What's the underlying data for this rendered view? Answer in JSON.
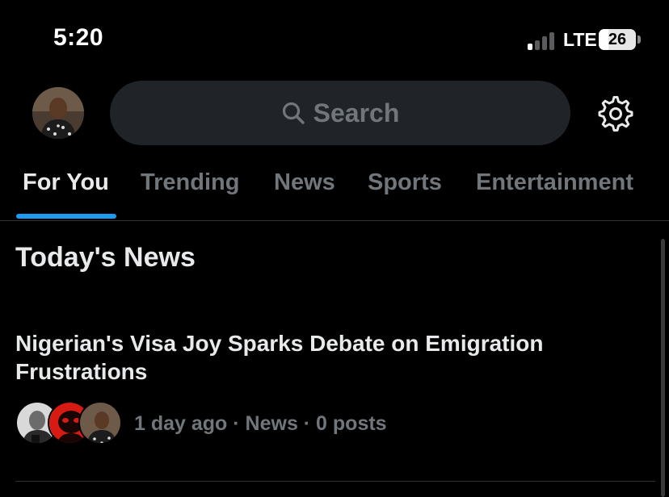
{
  "status_bar": {
    "time": "5:20",
    "network": "LTE",
    "battery": "26",
    "battery_fraction": 0.26
  },
  "header": {
    "avatar": "avatar",
    "search_label": "Search",
    "search_icon": "search-icon",
    "settings_icon": "gear-icon"
  },
  "tabs": [
    {
      "label": "For You",
      "active": true
    },
    {
      "label": "Trending",
      "active": false
    },
    {
      "label": "News",
      "active": false
    },
    {
      "label": "Sports",
      "active": false
    },
    {
      "label": "Entertainment",
      "active": false
    }
  ],
  "main": {
    "section_title": "Today's News",
    "stories": [
      {
        "headline": "Nigerian's Visa Joy Sparks Debate on Emigration Frustrations",
        "meta": "1 day ago · News · 0 posts"
      }
    ]
  },
  "colors": {
    "background": "#000000",
    "text_primary": "#e7e9ea",
    "text_secondary": "#71767b",
    "accent": "#1d9bf0",
    "search_bg": "#202327"
  }
}
